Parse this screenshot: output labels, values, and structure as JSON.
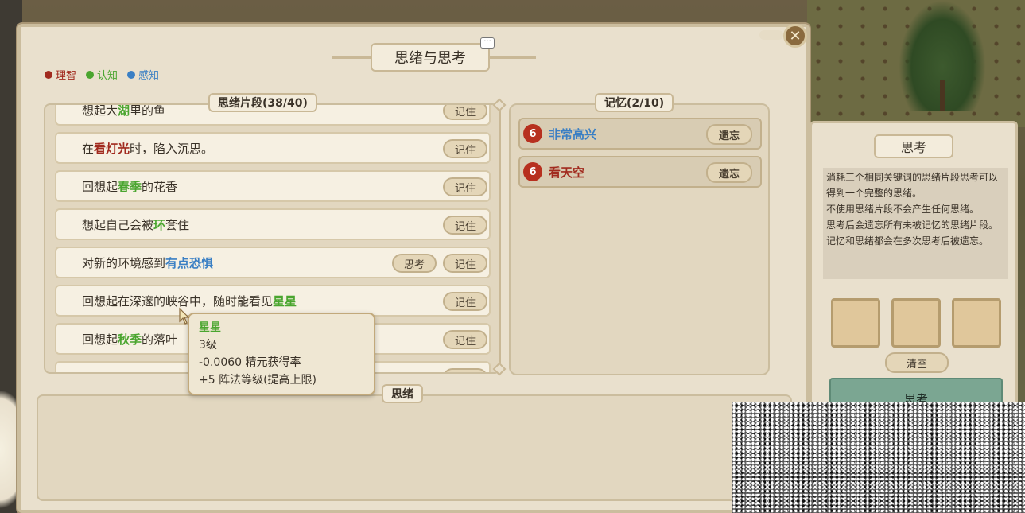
{
  "window": {
    "title": "思绪与思考",
    "close_label": "✕",
    "menu_label": "···"
  },
  "legend": [
    {
      "label": "理智",
      "color": "#a12a1e"
    },
    {
      "label": "认知",
      "color": "#4aa52f"
    },
    {
      "label": "感知",
      "color": "#3a7fc4"
    }
  ],
  "fragments": {
    "header": "思绪片段(38/40)",
    "rows": [
      {
        "pre": "想起大",
        "kw": "湖",
        "kw_color": "green",
        "post": "里的鱼",
        "btn": "记住"
      },
      {
        "pre": "在",
        "kw": "看灯光",
        "kw_color": "red",
        "post": "时，陷入沉思。",
        "btn": "记住"
      },
      {
        "pre": "回想起",
        "kw": "春季",
        "kw_color": "green",
        "post": "的花香",
        "btn": "记住"
      },
      {
        "pre": "想起自己会被",
        "kw": "环",
        "kw_color": "green",
        "post": "套住",
        "btn": "记住"
      },
      {
        "pre": "对新的环境感到",
        "kw": "有点恐惧",
        "kw_color": "blue",
        "post": "",
        "btn": "记住",
        "btn2": "思考"
      },
      {
        "pre": "回想起在深邃的峡谷中，随时能看见",
        "kw": "星星",
        "kw_color": "green",
        "post": "",
        "btn": "记住"
      },
      {
        "pre": "回想起",
        "kw": "秋季",
        "kw_color": "green",
        "post": "的落叶",
        "btn": "记住"
      },
      {
        "pre": "",
        "kw": "",
        "kw_color": "green",
        "post": "",
        "btn": "记住"
      }
    ]
  },
  "memory": {
    "header": "记忆(2/10)",
    "rows": [
      {
        "badge": "6",
        "label": "非常高兴",
        "color": "#3a7fc4",
        "btn": "遗忘"
      },
      {
        "badge": "6",
        "label": "看天空",
        "color": "#a12a1e",
        "btn": "遗忘"
      }
    ]
  },
  "thoughts": {
    "header": "思绪"
  },
  "tooltip": {
    "title": "星星",
    "level": "3级",
    "line1": "-0.0060  精元获得率",
    "line2": "+5  阵法等级(提高上限)"
  },
  "think": {
    "title": "思考",
    "description": "消耗三个相同关键词的思绪片段思考可以得到一个完整的思绪。\n不使用思绪片段不会产生任何思绪。\n思考后会遗忘所有未被记忆的思绪片段。\n记忆和思绪都会在多次思考后被遗忘。",
    "clear_label": "清空",
    "think_label": "思考"
  }
}
